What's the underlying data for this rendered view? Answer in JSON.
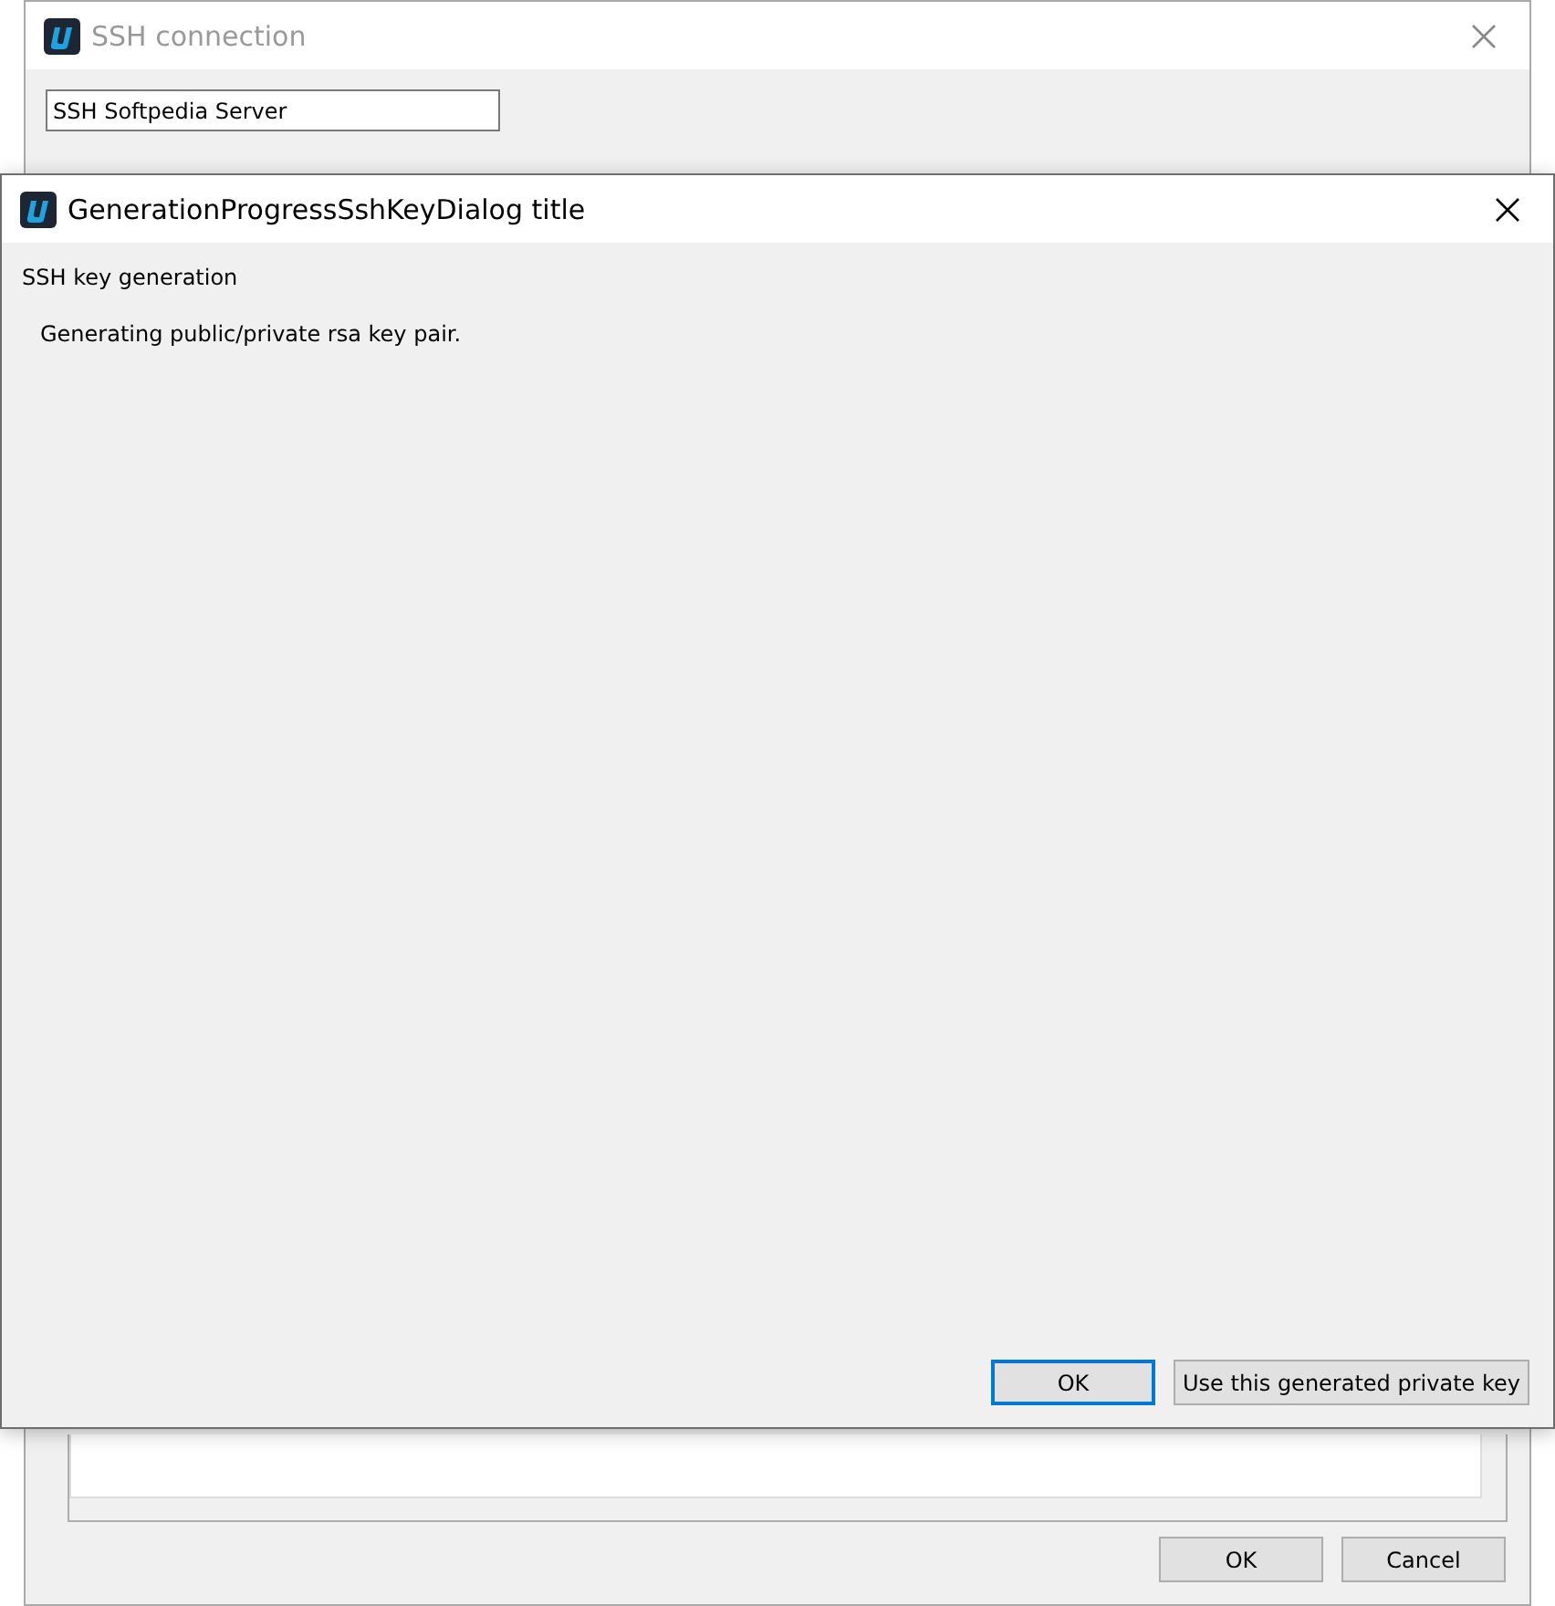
{
  "back_window": {
    "title": "SSH connection",
    "name_field": {
      "value": "SSH Softpedia Server"
    },
    "buttons": [
      {
        "label": "OK",
        "default": false
      },
      {
        "label": "Cancel",
        "default": false
      }
    ]
  },
  "dialog": {
    "title": "GenerationProgressSshKeyDialog title",
    "heading": "SSH key generation",
    "message": "Generating public/private rsa key pair.",
    "buttons": [
      {
        "label": "OK",
        "default": true
      },
      {
        "label": "Use this generated private key",
        "default": false
      }
    ]
  }
}
